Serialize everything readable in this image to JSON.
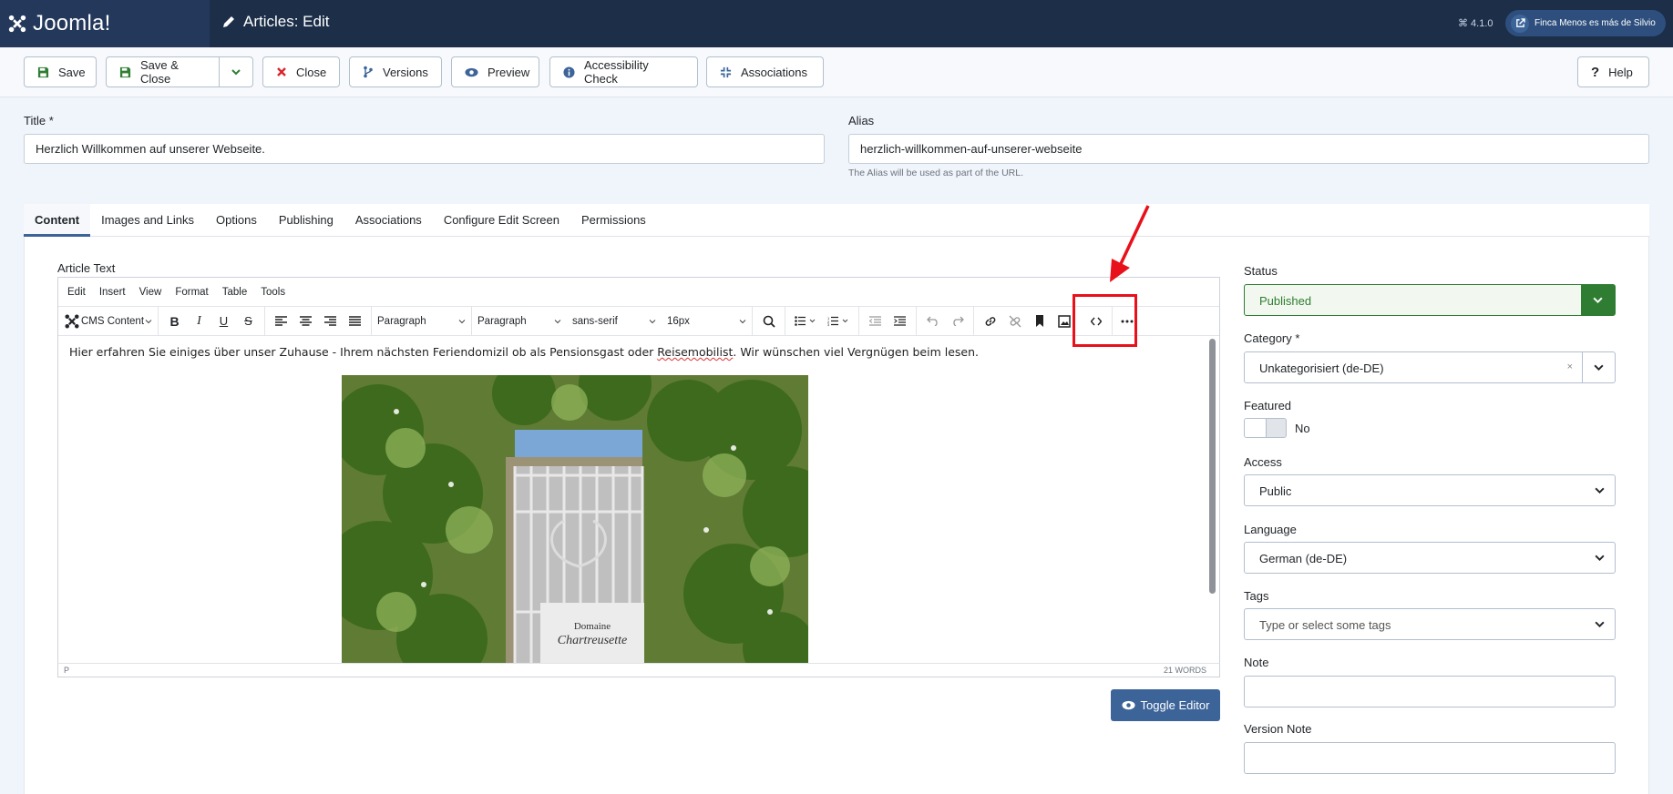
{
  "header": {
    "logo_text": "Joomla!",
    "page_title": "Articles: Edit",
    "version": "⌘ 4.1.0",
    "site_button": "Finca Menos es más de Silvio"
  },
  "toolbar": {
    "save": "Save",
    "save_close": "Save & Close",
    "close": "Close",
    "versions": "Versions",
    "preview": "Preview",
    "accessibility": "Accessibility Check",
    "associations": "Associations",
    "help": "Help"
  },
  "form": {
    "title_label": "Title *",
    "title_value": "Herzlich Willkommen auf unserer Webseite.",
    "alias_label": "Alias",
    "alias_value": "herzlich-willkommen-auf-unserer-webseite",
    "alias_hint": "The Alias will be used as part of the URL."
  },
  "tabs": [
    "Content",
    "Images and Links",
    "Options",
    "Publishing",
    "Associations",
    "Configure Edit Screen",
    "Permissions"
  ],
  "editor": {
    "label": "Article Text",
    "menus": [
      "Edit",
      "Insert",
      "View",
      "Format",
      "Table",
      "Tools"
    ],
    "cms_content": "CMS Content",
    "block_format": "Paragraph",
    "style_format": "Paragraph",
    "font_family": "sans-serif",
    "font_size": "16px",
    "text_before": "Hier erfahren Sie einiges über unser Zuhause - Ihrem nächsten Feriendomizil ob als Pensionsgast oder ",
    "text_spell": "Reisemobilist",
    "text_after": ". Wir wünschen viel Vergnügen beim lesen.",
    "image_sign_line1": "Domaine",
    "image_sign_line2": "Chartreusette",
    "path": "P",
    "word_count": "21 WORDS",
    "toggle_button": "Toggle Editor"
  },
  "sidebar": {
    "status_label": "Status",
    "status_value": "Published",
    "category_label": "Category *",
    "category_value": "Unkategorisiert (de-DE)",
    "featured_label": "Featured",
    "featured_value": "No",
    "access_label": "Access",
    "access_value": "Public",
    "language_label": "Language",
    "language_value": "German (de-DE)",
    "tags_label": "Tags",
    "tags_placeholder": "Type or select some tags",
    "note_label": "Note",
    "version_note_label": "Version Note"
  },
  "colors": {
    "header_bg": "#1c2e48",
    "accent": "#3c6499",
    "published_green": "#2f7d32",
    "annotation_red": "#e8101a"
  }
}
